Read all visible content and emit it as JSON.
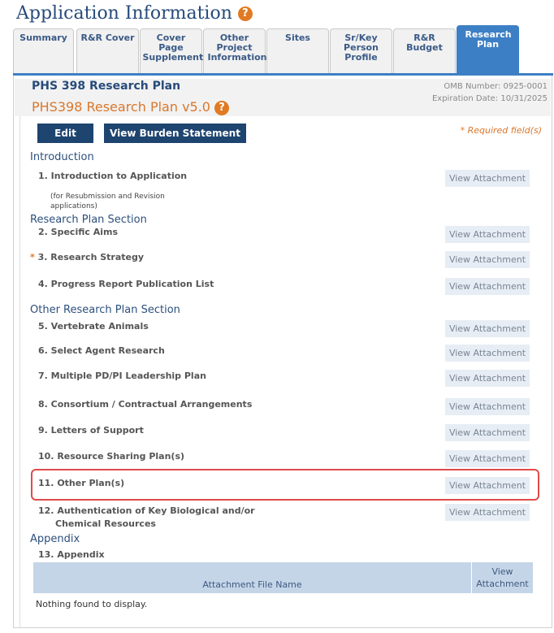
{
  "page": {
    "title": "Application Information"
  },
  "tabs": [
    {
      "label": "Summary"
    },
    {
      "label": "R&R Cover"
    },
    {
      "label": "Cover Page Supplement"
    },
    {
      "label": "Other Project Information"
    },
    {
      "label": "Sites"
    },
    {
      "label": "Sr/Key Person Profile"
    },
    {
      "label": "R&R Budget"
    },
    {
      "label": "Research Plan"
    }
  ],
  "plan": {
    "title": "PHS 398 Research Plan",
    "subtitle": "PHS398 Research Plan v5.0",
    "omb": "OMB Number: 0925-0001",
    "expiration": "Expiration Date: 10/31/2025"
  },
  "buttons": {
    "edit": "Edit",
    "burden": "View Burden Statement"
  },
  "required_note": "* Required field(s)",
  "sections": {
    "introduction": "Introduction",
    "research_plan": "Research Plan Section",
    "other_research_plan": "Other Research Plan Section",
    "appendix": "Appendix"
  },
  "items": {
    "i1": "1. Introduction to  Application",
    "i1_note": "(for Resubmission and Revision applications)",
    "i2": "2. Specific Aims",
    "i3": "3. Research Strategy",
    "i4": "4. Progress Report Publication List",
    "i5": "5. Vertebrate Animals",
    "i6": "6. Select Agent Research",
    "i7": "7. Multiple PD/PI  Leadership Plan",
    "i8": "8. Consortium / Contractual Arrangements",
    "i9": "9. Letters of Support",
    "i10": "10. Resource Sharing Plan(s)",
    "i11": "11. Other Plan(s)",
    "i12a": "12. Authentication of Key Biological and/or",
    "i12b": "Chemical Resources",
    "i13": "13. Appendix"
  },
  "required_marker": "*",
  "view_attachment": "View Attachment",
  "table": {
    "col_name": "Attachment File Name",
    "col_view_1": "View",
    "col_view_2": "Attachment",
    "empty": "Nothing found to display."
  }
}
